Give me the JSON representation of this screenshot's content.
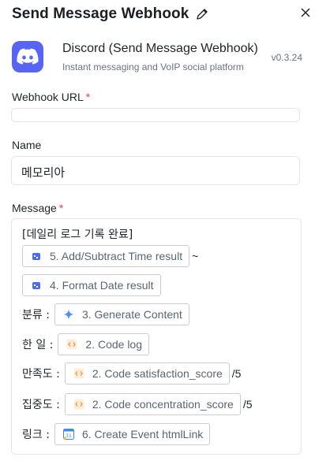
{
  "header": {
    "title": "Send Message Webhook"
  },
  "app": {
    "name": "Discord (Send Message Webhook)",
    "description": "Instant messaging and VoIP social platform",
    "version": "v0.3.24"
  },
  "fields": {
    "webhook": {
      "label": "Webhook URL",
      "required_mark": "*",
      "value": ""
    },
    "name": {
      "label": "Name",
      "value": "메모리아"
    },
    "message": {
      "label": "Message",
      "required_mark": "*",
      "first_line": "[데일리 로그 기록 완료]",
      "chips": {
        "c1": {
          "label": "5. Add/Subtract Time result",
          "suffix": "~"
        },
        "c2": {
          "label": "4. Format Date result"
        },
        "c3": {
          "prefix": "분류 :",
          "label": "3. Generate Content"
        },
        "c4": {
          "prefix": "한 일 :",
          "label": "2. Code log"
        },
        "c5": {
          "prefix": "만족도 :",
          "label": "2. Code satisfaction_score",
          "suffix": "/5"
        },
        "c6": {
          "prefix": "집중도 :",
          "label": "2. Code concentration_score",
          "suffix": "/5"
        },
        "c7": {
          "prefix": "링크 :",
          "label": "6. Create Event htmlLink"
        }
      }
    }
  },
  "colors": {
    "discord_blurple": "#5865f2",
    "required": "#e5484d",
    "border": "#e3e6ea"
  }
}
